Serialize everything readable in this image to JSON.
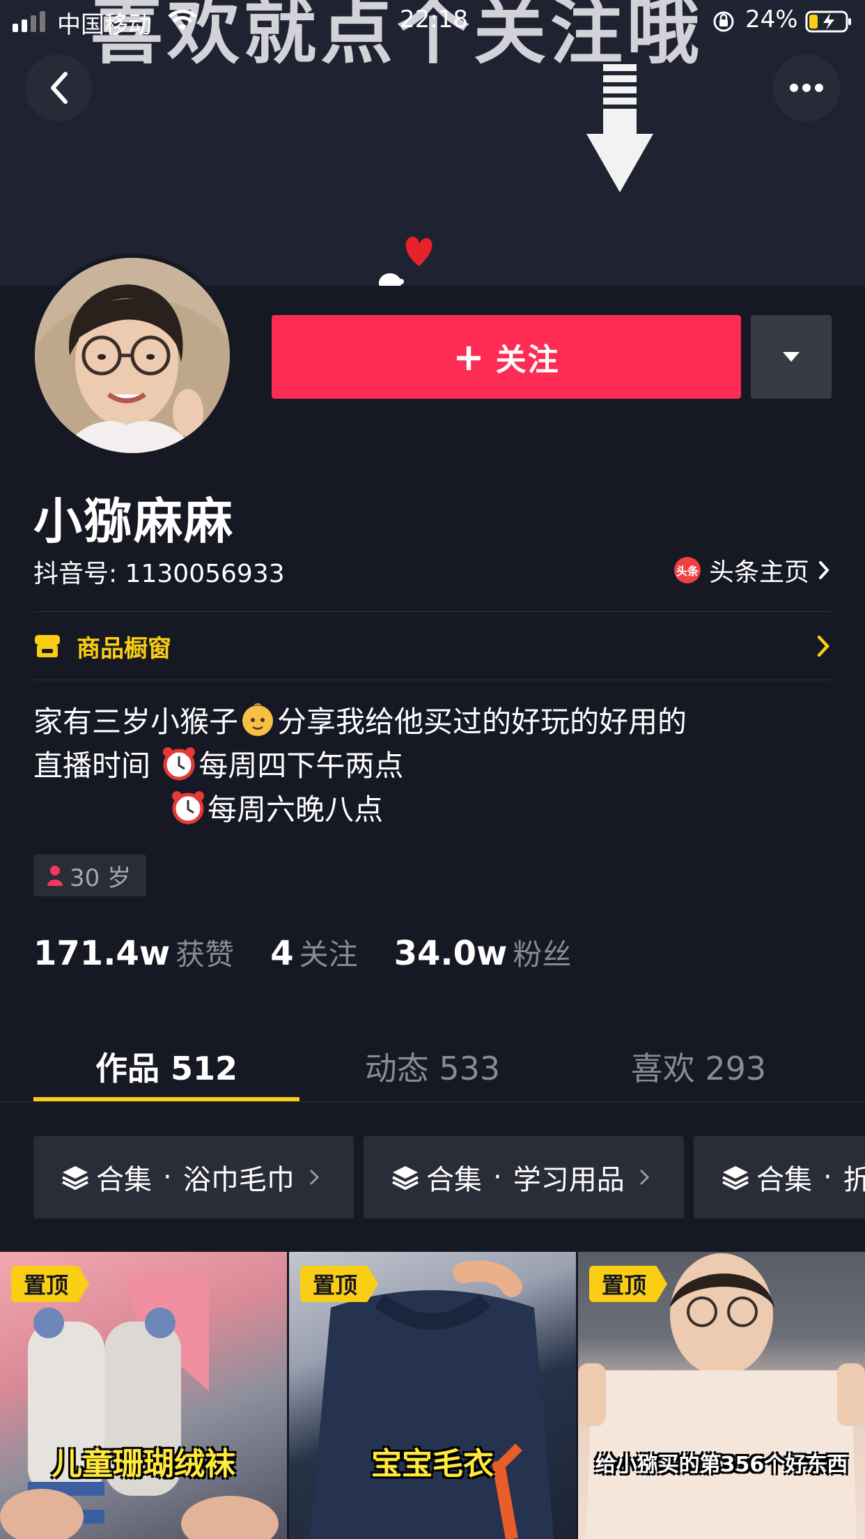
{
  "status_bar": {
    "carrier": "中国移动",
    "time": "22:18",
    "battery_percent": "24%"
  },
  "banner": {
    "overlay_text": "喜欢就点个关注哦"
  },
  "profile": {
    "follow_label": "关注",
    "name": "小猕麻麻",
    "douyin_id": "抖音号: 1130056933",
    "toutiao_link": "头条主页",
    "toutiao_badge": "头条",
    "shop_label": "商品橱窗",
    "bio": {
      "line1_part1": "家有三岁小猴子",
      "line1_part2": "分享我给他买过的好玩的好用的",
      "line2": "直播时间",
      "line2_schedule": "每周四下午两点",
      "line3_schedule": "每周六晚八点"
    },
    "age_tag": "30 岁",
    "stats": [
      {
        "value": "171.4w",
        "label": "获赞"
      },
      {
        "value": "4",
        "label": "关注"
      },
      {
        "value": "34.0w",
        "label": "粉丝"
      }
    ]
  },
  "tabs": [
    {
      "label": "作品 512",
      "active": true
    },
    {
      "label": "动态 533",
      "active": false
    },
    {
      "label": "喜欢 293",
      "active": false
    }
  ],
  "collections": [
    {
      "prefix": "合集",
      "name": "浴巾毛巾"
    },
    {
      "prefix": "合集",
      "name": "学习用品"
    },
    {
      "prefix": "合集",
      "name": "折"
    }
  ],
  "videos": [
    {
      "pin_label": "置顶",
      "caption": "儿童珊瑚绒袜"
    },
    {
      "pin_label": "置顶",
      "caption": "宝宝毛衣"
    },
    {
      "pin_label": "置顶",
      "caption": "给小猕买的第356个好东西"
    }
  ],
  "colors": {
    "background": "#161823",
    "follow_button": "#fe2c55",
    "accent_yellow": "#face15"
  }
}
